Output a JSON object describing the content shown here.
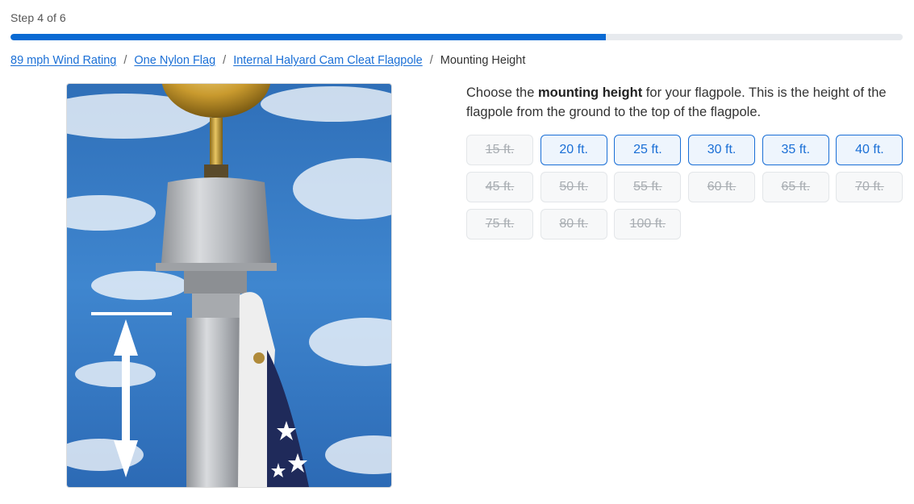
{
  "progress": {
    "step_label": "Step 4 of 6",
    "fraction": 0.667,
    "fill_color": "#0a6ad3",
    "track_color": "#e7eaee"
  },
  "breadcrumb": {
    "links": [
      "89 mph Wind Rating",
      "One Nylon Flag",
      "Internal Halyard Cam Cleat Flagpole"
    ],
    "separator": "/",
    "current": "Mounting Height"
  },
  "description": {
    "prefix": "Choose the ",
    "bold": "mounting height",
    "suffix": " for your flagpole. This is the height of the flagpole from the ground to the top of the flagpole."
  },
  "heights": [
    {
      "label": "15 ft.",
      "available": false
    },
    {
      "label": "20 ft.",
      "available": true
    },
    {
      "label": "25 ft.",
      "available": true
    },
    {
      "label": "30 ft.",
      "available": true
    },
    {
      "label": "35 ft.",
      "available": true
    },
    {
      "label": "40 ft.",
      "available": true
    },
    {
      "label": "45 ft.",
      "available": false
    },
    {
      "label": "50 ft.",
      "available": false
    },
    {
      "label": "55 ft.",
      "available": false
    },
    {
      "label": "60 ft.",
      "available": false
    },
    {
      "label": "65 ft.",
      "available": false
    },
    {
      "label": "70 ft.",
      "available": false
    },
    {
      "label": "75 ft.",
      "available": false
    },
    {
      "label": "80 ft.",
      "available": false
    },
    {
      "label": "100 ft.",
      "available": false
    }
  ],
  "colors": {
    "accent": "#1a6fd6",
    "disabled_text": "#a8adb2"
  }
}
